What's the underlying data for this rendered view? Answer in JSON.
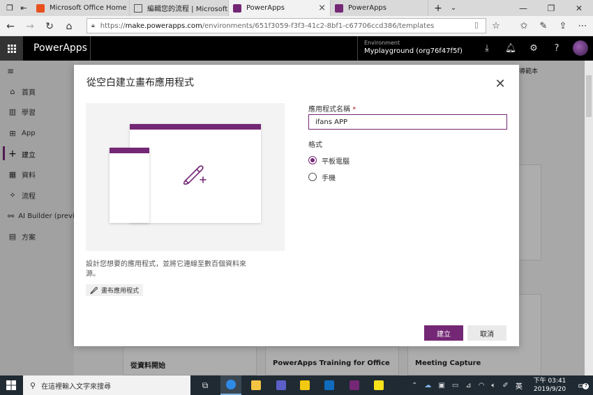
{
  "browser": {
    "tabs": [
      {
        "label": "Microsoft Office Home",
        "icon": "office-icon",
        "active": false
      },
      {
        "label": "編輯您的流程 | Microsoft Fl",
        "icon": "page-icon",
        "active": false
      },
      {
        "label": "PowerApps",
        "icon": "powerapps-icon",
        "active": true
      },
      {
        "label": "PowerApps",
        "icon": "powerapps-icon",
        "active": false
      }
    ],
    "url_prefix": "https://",
    "url_domain": "make.powerapps.com",
    "url_path": "/environments/651f3059-f3f3-41c2-8bf1-c67706ccd386/templates"
  },
  "app_header": {
    "brand": "PowerApps",
    "environment_label": "Environment",
    "environment_name": "Myplayground (org76f47f5f)"
  },
  "sidebar": {
    "items": [
      {
        "label": "首頁",
        "icon": "home-icon"
      },
      {
        "label": "學習",
        "icon": "book-icon"
      },
      {
        "label": "App",
        "icon": "apps-icon"
      },
      {
        "label": "建立",
        "icon": "plus-icon",
        "active": true
      },
      {
        "label": "資料",
        "icon": "table-icon"
      },
      {
        "label": "流程",
        "icon": "flow-icon"
      },
      {
        "label": "AI Builder (preview)",
        "icon": "ai-icon"
      },
      {
        "label": "方案",
        "icon": "solution-icon"
      }
    ]
  },
  "background": {
    "top_right_text": "導範本",
    "cards": [
      {
        "title": "從資料開始"
      },
      {
        "title": "PowerApps Training for Office"
      },
      {
        "title": "Meeting Capture"
      }
    ]
  },
  "dialog": {
    "title": "從空白建立畫布應用程式",
    "description": "設計您想要的應用程式，並將它連線至數百個資料來源。",
    "chip_label": "畫布應用程式",
    "name_label": "應用程式名稱",
    "required_mark": "*",
    "name_value": "ifans APP",
    "format_label": "格式",
    "format_options": [
      {
        "label": "平板電腦",
        "selected": true
      },
      {
        "label": "手機",
        "selected": false
      }
    ],
    "create_label": "建立",
    "cancel_label": "取消"
  },
  "taskbar": {
    "search_placeholder": "在這裡輸入文字來搜尋",
    "ime": "英",
    "time": "下午 03:41",
    "date": "2019/9/20",
    "notification_count": "7"
  },
  "colors": {
    "accent": "#742774",
    "header": "#000000",
    "taskbar": "#1f2a33"
  }
}
